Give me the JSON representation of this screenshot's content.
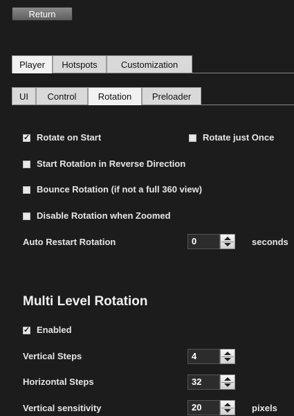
{
  "header": {
    "return_label": "Return"
  },
  "main_tabs": [
    {
      "label": "Player",
      "active": true
    },
    {
      "label": "Hotspots",
      "active": false
    },
    {
      "label": "Customization",
      "active": false
    }
  ],
  "sub_tabs": [
    {
      "label": "UI",
      "active": false
    },
    {
      "label": "Control",
      "active": false
    },
    {
      "label": "Rotation",
      "active": true
    },
    {
      "label": "Preloader",
      "active": false
    }
  ],
  "rotation": {
    "rotate_on_start": {
      "label": "Rotate on Start",
      "checked": true
    },
    "rotate_just_once": {
      "label": "Rotate just Once",
      "checked": false
    },
    "reverse_direction": {
      "label": "Start Rotation in Reverse Direction",
      "checked": false
    },
    "bounce_rotation": {
      "label": "Bounce Rotation (if not a full 360 view)",
      "checked": false
    },
    "disable_when_zoomed": {
      "label": "Disable Rotation when Zoomed",
      "checked": false
    },
    "auto_restart": {
      "label": "Auto Restart Rotation",
      "value": "0",
      "unit": "seconds"
    }
  },
  "multi_level": {
    "title": "Multi Level Rotation",
    "enabled": {
      "label": "Enabled",
      "checked": true
    },
    "vertical_steps": {
      "label": "Vertical Steps",
      "value": "4"
    },
    "horizontal_steps": {
      "label": "Horizontal Steps",
      "value": "32"
    },
    "vertical_sensitivity": {
      "label": "Vertical sensitivity",
      "value": "20",
      "unit": "pixels"
    }
  },
  "colors": {
    "background": "#1c1c1c",
    "tab_active": "#f2f2f2",
    "tab_inactive": "#d9d9d9"
  }
}
